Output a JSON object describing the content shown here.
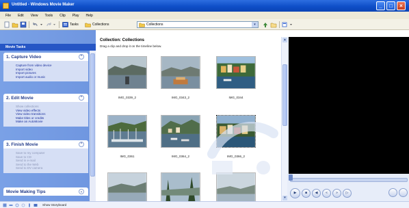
{
  "window": {
    "title": "Untitled - Windows Movie Maker"
  },
  "menu": [
    "File",
    "Edit",
    "View",
    "Tools",
    "Clip",
    "Play",
    "Help"
  ],
  "toolbar": {
    "tasks_label": "Tasks",
    "collections_label": "Collections",
    "combo_value": "Collections"
  },
  "task_pane": {
    "header": "Movie Tasks",
    "panels": [
      {
        "title": "1. Capture Video",
        "links": [
          "Capture from video device",
          "Import video",
          "Import pictures",
          "Import audio or music"
        ]
      },
      {
        "title": "2. Edit Movie",
        "links": [
          "Show collections",
          "View video effects",
          "View video transitions",
          "Make titles or credits",
          "Make an AutoMovie"
        ]
      },
      {
        "title": "3. Finish Movie",
        "links": [
          "Save to my computer",
          "Save to CD",
          "Send in e-mail",
          "Send to the Web",
          "Send to DV camera"
        ]
      },
      {
        "title": "Movie Making Tips",
        "links": []
      }
    ]
  },
  "collection": {
    "title": "Collection: Collections",
    "subtitle": "Drag a clip and drop it on the timeline below.",
    "items": [
      {
        "caption": "IMG_0339_2"
      },
      {
        "caption": "IMG_0343_2"
      },
      {
        "caption": "IMG_0344"
      },
      {
        "caption": "IMG_0361"
      },
      {
        "caption": "IMG_0364_2"
      },
      {
        "caption": "IMG_0366_2"
      },
      {
        "caption": ""
      },
      {
        "caption": ""
      },
      {
        "caption": ""
      }
    ]
  },
  "storyboard": {
    "label": "Show Storyboard"
  },
  "colors": {
    "titlebar": "#0f4fc8",
    "task_pane_bg": "#7aa1e6",
    "task_header_bg": "#2656c5",
    "link": "#1a2f9c",
    "monitor_screen": "#000000"
  }
}
